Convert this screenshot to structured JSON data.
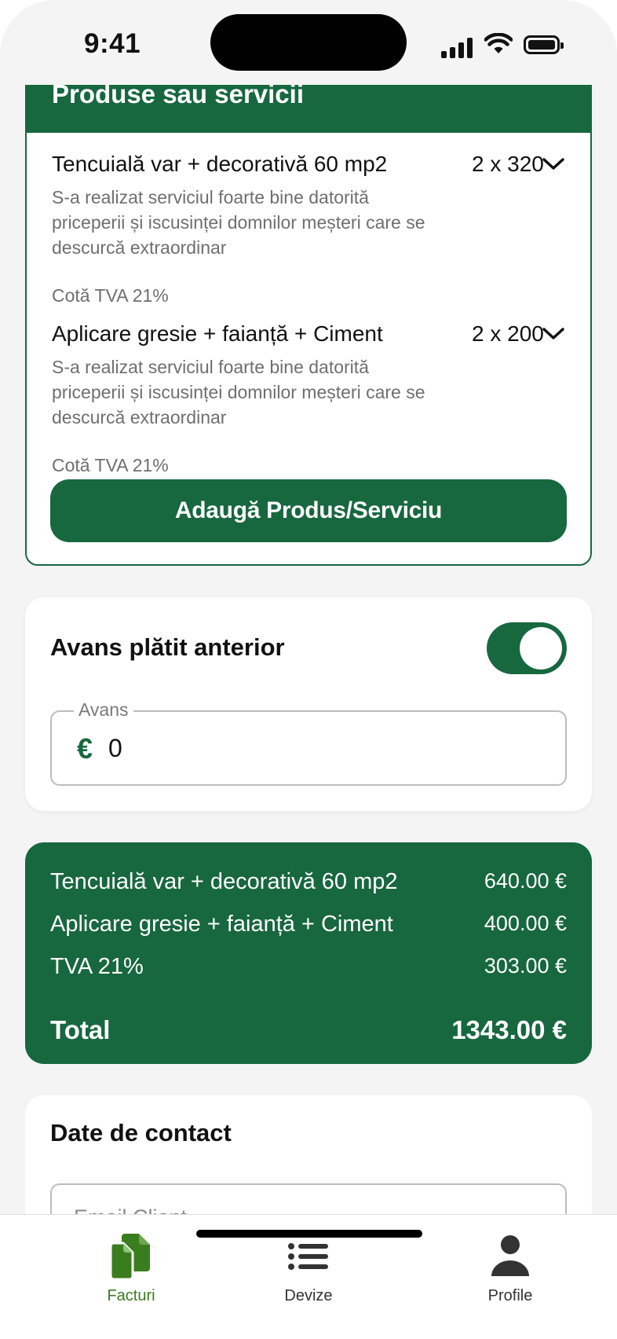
{
  "status_bar": {
    "time": "9:41"
  },
  "products": {
    "header": "Produse sau servicii",
    "items": [
      {
        "title": "Tencuială var + decorativă 60 mp2",
        "qty": "2 x 320",
        "description": "S-a realizat serviciul foarte bine datorită priceperii și iscusinței domnilor meșteri care se descurcă extraordinar",
        "vat": "Cotă TVA 21%"
      },
      {
        "title": "Aplicare gresie + faianță + Ciment",
        "qty": "2 x 200",
        "description": "S-a realizat serviciul foarte bine datorită priceperii și iscusinței domnilor meșteri care se descurcă extraordinar",
        "vat": "Cotă TVA 21%"
      }
    ],
    "add_button": "Adaugă Produs/Serviciu"
  },
  "advance": {
    "title": "Avans plătit anterior",
    "toggle_on": true,
    "field_label": "Avans",
    "currency_symbol": "€",
    "value": "0"
  },
  "summary": {
    "rows": [
      {
        "label": "Tencuială var + decorativă 60 mp2",
        "value": "640.00 €"
      },
      {
        "label": "Aplicare gresie + faianță + Ciment",
        "value": "400.00 €"
      },
      {
        "label": "TVA 21%",
        "value": "303.00 €"
      }
    ],
    "total_label": "Total",
    "total_value": "1343.00 €"
  },
  "contact": {
    "title": "Date de contact",
    "email_placeholder": "Email Client"
  },
  "nav": {
    "items": [
      {
        "label": "Facturi",
        "icon": "documents-icon",
        "active": true
      },
      {
        "label": "Devize",
        "icon": "list-icon",
        "active": false
      },
      {
        "label": "Profile",
        "icon": "person-icon",
        "active": false
      }
    ]
  },
  "colors": {
    "primary": "#17673f",
    "active_nav": "#3a7d1e",
    "background": "#f4f4f4"
  }
}
